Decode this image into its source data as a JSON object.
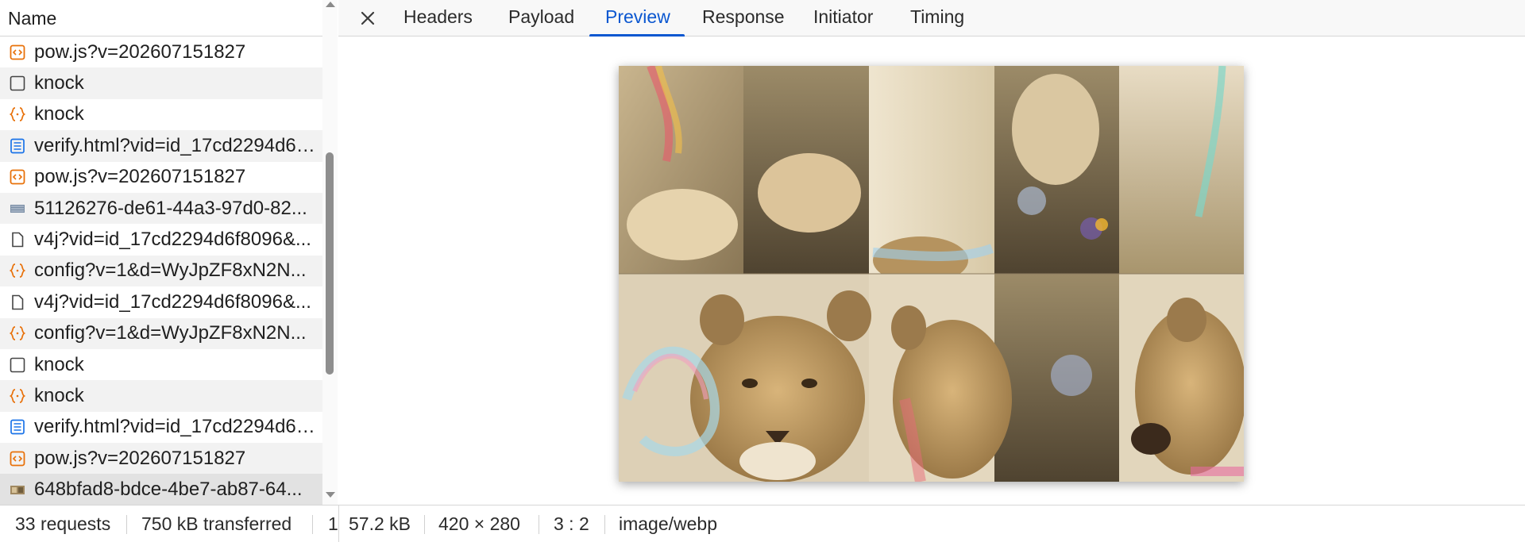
{
  "request_list": {
    "header": "Name",
    "rows": [
      {
        "name": "pow.js?v=202607151827",
        "icon": "script-icon"
      },
      {
        "name": "knock",
        "icon": "checkbox-icon"
      },
      {
        "name": "knock",
        "icon": "fetch-icon"
      },
      {
        "name": "verify.html?vid=id_17cd2294d6f8096&...",
        "icon": "document-icon"
      },
      {
        "name": "pow.js?v=202607151827",
        "icon": "script-icon"
      },
      {
        "name": "51126276-de61-44a3-97d0-82...",
        "icon": "image-icon"
      },
      {
        "name": "v4j?vid=id_17cd2294d6f8096&...",
        "icon": "file-icon"
      },
      {
        "name": "config?v=1&d=WyJpZF8xN2N...",
        "icon": "fetch-icon"
      },
      {
        "name": "v4j?vid=id_17cd2294d6f8096&...",
        "icon": "file-icon"
      },
      {
        "name": "config?v=1&d=WyJpZF8xN2N...",
        "icon": "fetch-icon"
      },
      {
        "name": "knock",
        "icon": "checkbox-icon"
      },
      {
        "name": "knock",
        "icon": "fetch-icon"
      },
      {
        "name": "verify.html?vid=id_17cd2294d6f8096&...",
        "icon": "document-icon"
      },
      {
        "name": "pow.js?v=202607151827",
        "icon": "script-icon"
      },
      {
        "name": "648bfad8-bdce-4be7-ab87-64...",
        "icon": "image-thumb-icon"
      }
    ],
    "scroll_fraction": 0.55
  },
  "tabs": [
    {
      "label": "Headers",
      "active": false
    },
    {
      "label": "Payload",
      "active": false
    },
    {
      "label": "Preview",
      "active": true
    },
    {
      "label": "Response",
      "active": false
    },
    {
      "label": "Initiator",
      "active": false
    },
    {
      "label": "Timing",
      "active": false
    }
  ],
  "close_icon": "close-icon",
  "status": {
    "requests": "33 requests",
    "transferred": "750 kB transferred",
    "truncated": "1",
    "size": "57.2 kB",
    "dimensions": "420 × 280",
    "ratio": "3 : 2",
    "mime": "image/webp"
  },
  "colors": {
    "accent": "#0b57d0",
    "script_icon": "#e8710a",
    "document_icon": "#1a73e8"
  }
}
